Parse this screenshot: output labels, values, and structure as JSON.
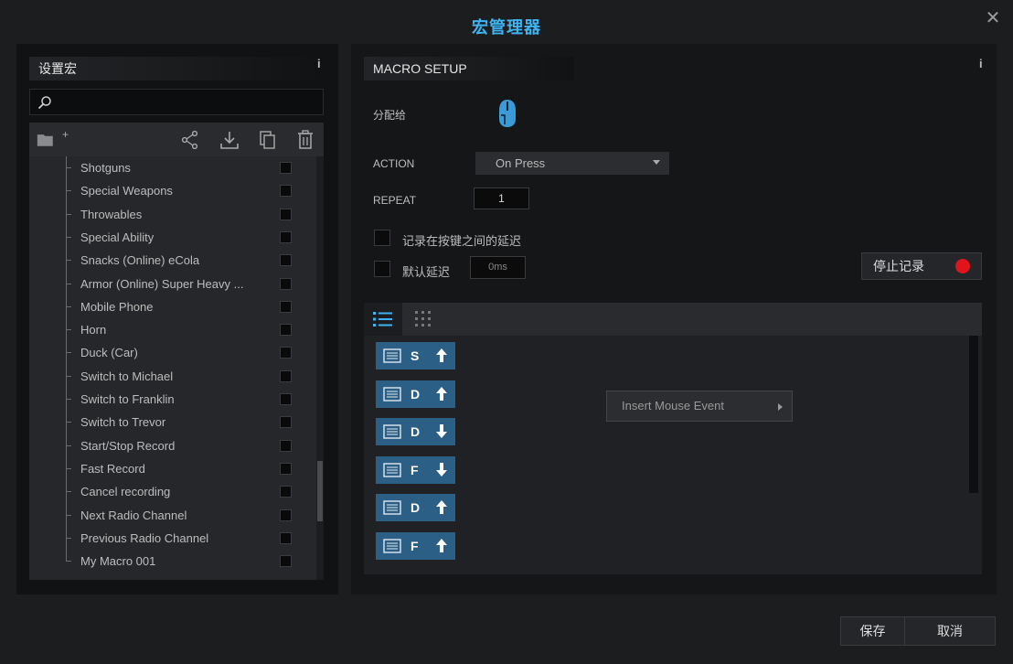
{
  "window": {
    "title": "宏管理器",
    "close_icon": "close-icon"
  },
  "library": {
    "header": "设置宏",
    "info": "i",
    "search": {
      "value": "",
      "placeholder": ""
    },
    "toolbar": {
      "folder_icon": "folder-add-icon",
      "folder_plus": "+",
      "share_icon": "share-icon",
      "download_icon": "download-icon",
      "copy_icon": "copy-icon",
      "delete_icon": "trash-icon"
    },
    "items": [
      {
        "label": "Shotguns"
      },
      {
        "label": "Special Weapons"
      },
      {
        "label": "Throwables"
      },
      {
        "label": "Special Ability"
      },
      {
        "label": "Snacks (Online) eCola"
      },
      {
        "label": "Armor (Online) Super Heavy ..."
      },
      {
        "label": "Mobile Phone"
      },
      {
        "label": "Horn"
      },
      {
        "label": "Duck (Car)"
      },
      {
        "label": "Switch to Michael"
      },
      {
        "label": "Switch to Franklin"
      },
      {
        "label": "Switch to Trevor"
      },
      {
        "label": "Start/Stop Record"
      },
      {
        "label": "Fast Record"
      },
      {
        "label": "Cancel recording"
      },
      {
        "label": "Next Radio Channel"
      },
      {
        "label": "Previous Radio Channel"
      },
      {
        "label": "My Macro 001"
      }
    ]
  },
  "setup": {
    "header": "MACRO SETUP",
    "info": "i",
    "assign_label": "分配给",
    "mouse_icon": "mouse-icon",
    "action_label": "ACTION",
    "action_value": "On Press",
    "repeat_label": "REPEAT",
    "repeat_value": "1",
    "option1_label": "记录在按键之间的延迟",
    "option2_label": "默认延迟",
    "delay_placeholder": "0ms",
    "stop_record_label": "停止记录",
    "rec_color": "#e0141a",
    "accent_color": "#2c5f86",
    "view_tabs": [
      {
        "icon": "list-view-icon"
      },
      {
        "icon": "grid-view-icon"
      }
    ],
    "events": [
      {
        "key": "S",
        "direction": "up"
      },
      {
        "key": "D",
        "direction": "up"
      },
      {
        "key": "D",
        "direction": "down"
      },
      {
        "key": "F",
        "direction": "down"
      },
      {
        "key": "D",
        "direction": "up"
      },
      {
        "key": "F",
        "direction": "up"
      }
    ],
    "insert_label": "Insert Mouse Event"
  },
  "footer": {
    "save_label": "保存",
    "cancel_label": "取消"
  }
}
